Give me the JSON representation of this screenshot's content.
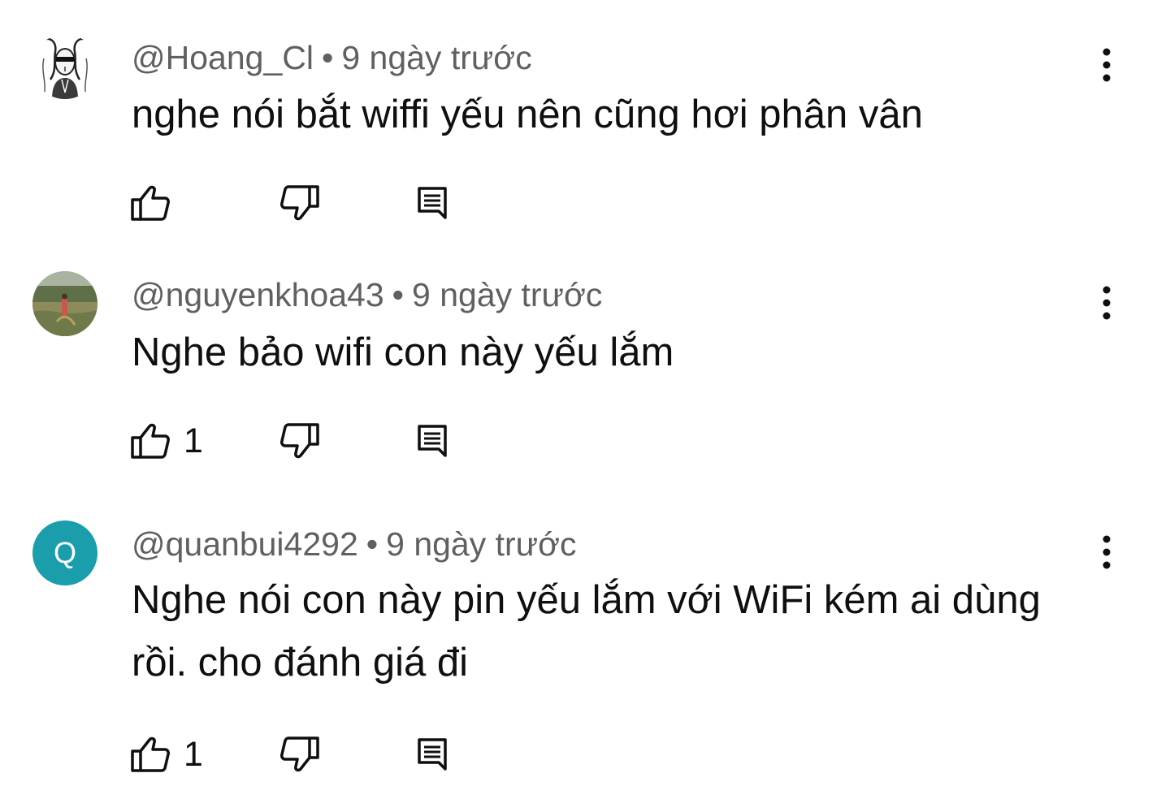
{
  "comments": [
    {
      "author": "@Hoang_Cl",
      "separator": "•",
      "time": "9 ngày trước",
      "text": "nghe nói bắt wiffi yếu nên cũng hơi phân vân",
      "likes": "",
      "avatar": "sketch-portrait-avatar"
    },
    {
      "author": "@nguyenkhoa43",
      "separator": "•",
      "time": "9 ngày trước",
      "text": "Nghe bảo wifi con này yếu lắm",
      "likes": "1",
      "avatar": "field-photo-avatar"
    },
    {
      "author": "@quanbui4292",
      "separator": "•",
      "time": "9 ngày trước",
      "text": "Nghe nói con này pin yếu lắm với WiFi kém ai dùng rồi. cho đánh giá đi",
      "likes": "1",
      "avatar_letter": "Q",
      "avatar_color": "#1a9eab"
    }
  ],
  "icons": {
    "like": "thumbs-up-icon",
    "dislike": "thumbs-down-icon",
    "reply": "reply-comment-icon",
    "more": "more-vertical-icon"
  },
  "colors": {
    "meta_text": "#606060",
    "body_text": "#0f0f0f"
  }
}
